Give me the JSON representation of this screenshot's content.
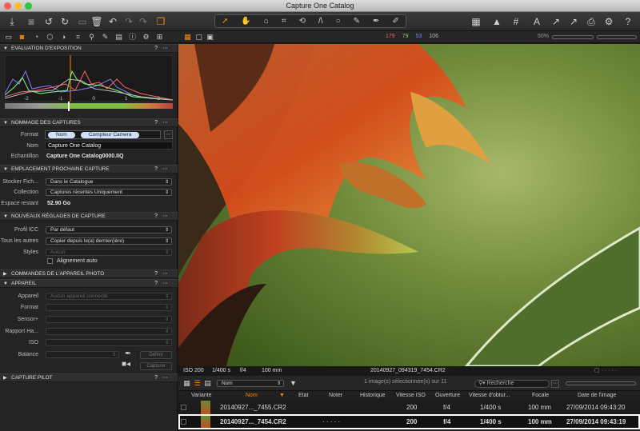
{
  "window": {
    "title": "Capture One Catalog"
  },
  "colors": {
    "accent": "#ff8a00",
    "red": "#ff6060",
    "green": "#90d060",
    "blue": "#8080ff"
  },
  "toolbar": {
    "icons": [
      "import-icon",
      "camera-icon",
      "rotate-left-icon",
      "rotate-right-icon",
      "folder-icon",
      "trash-icon",
      "undo-icon",
      "redo-icon",
      "redo-alt-icon",
      "copy-adjustments-icon"
    ],
    "right_icons": [
      "grid-layout-icon",
      "warning-icon",
      "grid-icon",
      "text-icon",
      "export-icon",
      "print-icon",
      "gear-icon",
      "help-icon"
    ]
  },
  "tabs": {
    "counts": {
      "r": "179",
      "g": "79",
      "b": "53",
      "a": "106"
    },
    "zoom": "50%"
  },
  "exposure": {
    "title": "EVALUATION D'EXPOSITION",
    "scale": [
      "-2",
      "-1",
      "0",
      "1",
      "2"
    ]
  },
  "naming": {
    "title": "NOMMAGE DES CAPTURES",
    "format_label": "Format",
    "token1": "Nom",
    "token2": "Compteur Camera",
    "name_label": "Nom",
    "name_value": "Capture One Catalog",
    "sample_label": "Echantillon",
    "sample_value": "Capture One Catalog0000.IIQ"
  },
  "location": {
    "title": "EMPLACEMENT PROCHAINE CAPTURE",
    "store_label": "Stocker Fich...",
    "store_value": "Dans le Catalogue",
    "collection_label": "Collection",
    "collection_value": "Captures récentes Uniquement",
    "space_label": "Espace restant",
    "space_value": "52.90 Go"
  },
  "settings": {
    "title": "NOUVEAUX RÉGLAGES DE CAPTURE",
    "icc_label": "Profil ICC",
    "icc_value": "Par défaut",
    "others_label": "Tous les autres",
    "others_value": "Copier depuis le(a) dernier(ière)",
    "styles_label": "Styles",
    "styles_value": "Aucun",
    "auto_align": "Alignement auto"
  },
  "camera_commands": {
    "title": "COMMANDES DE L'APPAREIL PHOTO"
  },
  "camera": {
    "title": "APPAREIL",
    "device_label": "Appareil",
    "device_value": "Aucun appareil connecté",
    "format_label": "Format",
    "sensor_label": "Sensor+",
    "ratio_label": "Rapport Ha...",
    "iso_label": "ISO",
    "balance_label": "Balance",
    "define_label": "Définir",
    "capture_label": "Capturer"
  },
  "pilot": {
    "title": "CAPTURE PILOT"
  },
  "viewer": {
    "iso": "ISO 200",
    "shutter": "1/400 s",
    "aperture": "f/4",
    "focal": "100 mm",
    "filename": "20140927_094319_7454.CR2"
  },
  "browser": {
    "sort": "Nom",
    "selection": "1 image(s) sélectionnée(s) sur 11",
    "search_placeholder": "Recherche"
  },
  "columns": [
    "Variante",
    "Nom",
    "Etat",
    "Noter",
    "Historique",
    "Vitesse ISO",
    "Ouverture",
    "Vitesse d'obtur...",
    "Focale",
    "Date de l'image"
  ],
  "rows": [
    {
      "name": "20140927..._7455.CR2",
      "rating": "",
      "iso": "200",
      "aperture": "f/4",
      "shutter": "1/400 s",
      "focal": "100 mm",
      "date": "27/09/2014 09:43:20"
    },
    {
      "name": "20140927..._7454.CR2",
      "rating": "· · · · ·",
      "iso": "200",
      "aperture": "f/4",
      "shutter": "1/400 s",
      "focal": "100 mm",
      "date": "27/09/2014 09:43:19"
    }
  ]
}
